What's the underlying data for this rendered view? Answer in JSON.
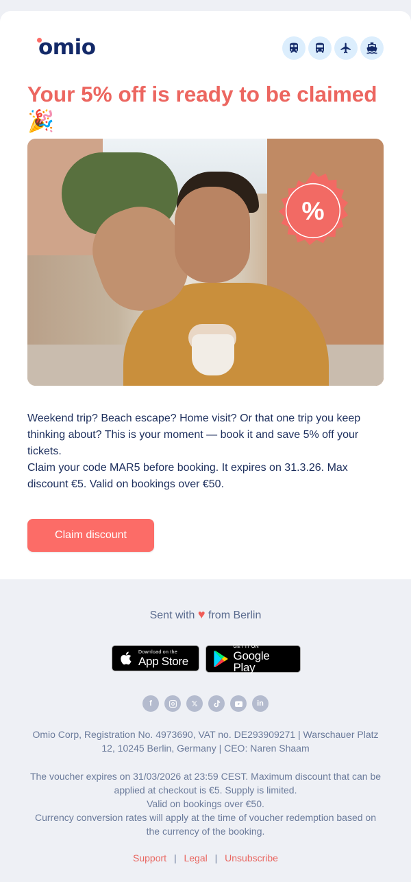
{
  "header": {
    "logo_text": "omio",
    "modes": [
      {
        "icon": "train-icon"
      },
      {
        "icon": "bus-icon"
      },
      {
        "icon": "plane-icon"
      },
      {
        "icon": "ferry-icon"
      }
    ]
  },
  "headline": "Your 5% off is ready to be claimed 🎉",
  "hero": {
    "badge_symbol": "%"
  },
  "body": {
    "paragraph1": "Weekend trip? Beach escape? Home visit? Or that one trip you keep thinking about? This is your moment — book it and save 5% off your tickets.",
    "paragraph2": "Claim your code MAR5 before booking. It expires on 31.3.26. Max discount €5. Valid on bookings over €50."
  },
  "cta": {
    "label": "Claim discount"
  },
  "footer": {
    "sent_prefix": "Sent with",
    "sent_suffix": "from Berlin",
    "app_store": {
      "small": "Download on the",
      "big": "App Store"
    },
    "google_play": {
      "small": "GET IT ON",
      "big": "Google Play"
    },
    "socials": [
      "facebook-icon",
      "instagram-icon",
      "x-icon",
      "tiktok-icon",
      "youtube-icon",
      "linkedin-icon"
    ],
    "company": "Omio Corp, Registration No. 4973690, VAT no. DE293909271 | Warschauer Platz 12, 10245 Berlin, Germany | CEO: Naren Shaam",
    "legal_lines": [
      "The voucher expires on 31/03/2026 at 23:59 CEST. Maximum discount that can be applied at checkout is €5. Supply is limited.",
      "Valid on bookings over €50.",
      "Currency conversion rates will apply at the time of voucher redemption based on the currency of the booking."
    ],
    "links": {
      "support": "Support",
      "legal": "Legal",
      "unsubscribe": "Unsubscribe",
      "separator": "|"
    }
  },
  "colors": {
    "brand_coral": "#fc6c67",
    "navy": "#132968",
    "mode_bg": "#dceefd"
  }
}
